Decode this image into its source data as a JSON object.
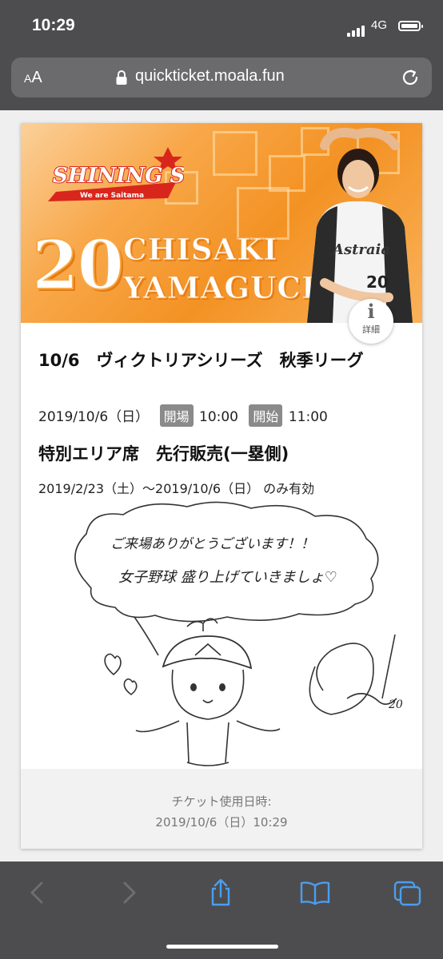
{
  "status": {
    "time": "10:29",
    "network": "4G"
  },
  "browser": {
    "aa_small": "A",
    "aa_big": "A",
    "url": "quickticket.moala.fun"
  },
  "banner": {
    "logo_text": "SHINING S",
    "logo_tagline": "We are Saitama",
    "player_number": "20",
    "player_first": "CHISAKI",
    "player_last": "YAMAGUCHI",
    "info_label": "詳細"
  },
  "ticket": {
    "event_title": "10/6　ヴィクトリアシリーズ　秋季リーグ",
    "event_date": "2019/10/6（日）",
    "open_label": "開場",
    "open_time": "10:00",
    "start_label": "開始",
    "start_time": "11:00",
    "seat_title": "特別エリア席　先行販売(一塁側)",
    "validity": "2019/2/23（土）～2019/10/6（日） のみ有効",
    "message_line1": "ご来場ありがとうございます！！",
    "message_line2": "女子野球 盛り上げていきましょ♡",
    "signature": "20"
  },
  "footer": {
    "used_label": "チケット使用日時:",
    "used_datetime": "2019/10/6（日）10:29"
  },
  "colors": {
    "banner_orange": "#f39224",
    "toolbar_blue": "#4a9ef0",
    "toolbar_disabled": "#6e6e70"
  }
}
